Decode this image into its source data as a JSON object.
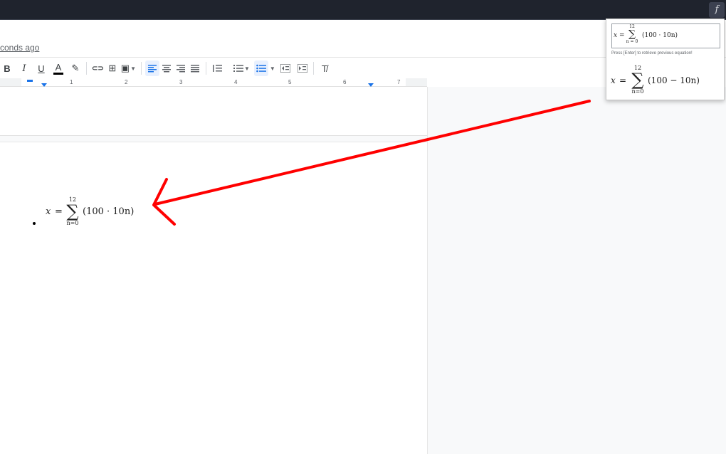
{
  "browser": {
    "extension_button": {
      "icon": "function-icon",
      "glyph": "f"
    }
  },
  "header": {
    "last_edit": "conds ago"
  },
  "toolbar": {
    "bold": "B",
    "italic": "I",
    "underline": "U",
    "text_color": "A",
    "highlight_glyph": "✎",
    "link_glyph": "⊂⊃",
    "comment_glyph": "⊞",
    "image_glyph": "▣",
    "clear_format_glyph": "T̸",
    "text_color_value": "#000000"
  },
  "ruler": {
    "numbers": [
      "1",
      "2",
      "3",
      "4",
      "5",
      "6",
      "7"
    ]
  },
  "document": {
    "equation": {
      "lhs": "x",
      "equals": "=",
      "upper": "12",
      "lower": "n=0",
      "body": "(100 · 10n)"
    }
  },
  "popup": {
    "input_equation": {
      "lhs": "x",
      "equals": "=",
      "upper": "12",
      "lower": "n = 0",
      "body": "(100 · 10n)"
    },
    "hint": "Press [Enter] to retrieve previous equation!",
    "preview_equation": {
      "lhs": "x",
      "equals": "=",
      "upper": "12",
      "lower": "n=0",
      "body": "(100 − 10n)"
    }
  },
  "colors": {
    "annotation_arrow": "#ff0000",
    "accent": "#1a73e8"
  }
}
